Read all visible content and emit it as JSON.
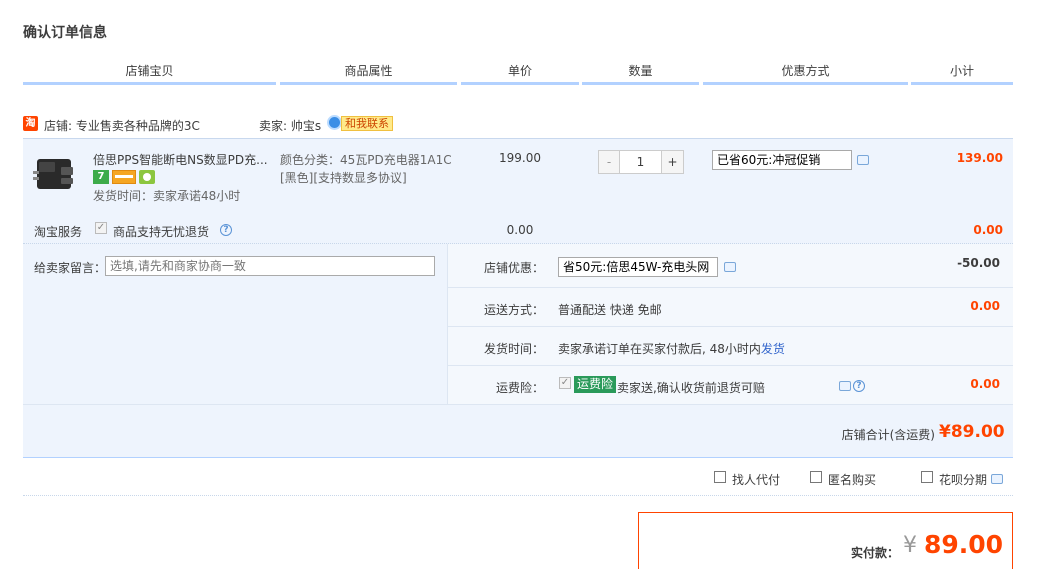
{
  "page": {
    "title": "确认订单信息"
  },
  "columns": [
    "店铺宝贝",
    "商品属性",
    "单价",
    "数量",
    "优惠方式",
    "小计"
  ],
  "shop": {
    "taobao_badge": "淘",
    "shop_label": "店铺: 专业售卖各种品牌的3C",
    "seller_label": "卖家: 帅宝s",
    "contact_label": "和我联系"
  },
  "item": {
    "name": "倍思PPS智能断电NS数显PD充...",
    "badge_7": "7",
    "ship_time": "发货时间：卖家承诺48小时",
    "attr_line1": "颜色分类：45瓦PD充电器1A1C",
    "attr_line2": "[黑色][支持数显多协议]",
    "unit_price": "199.00",
    "qty_minus": "-",
    "qty_value": "1",
    "qty_plus": "+",
    "discount_value": "已省60元:冲冠促销",
    "subtotal": "139.00"
  },
  "service": {
    "label": "淘宝服务",
    "option_label": "商品支持无忧退货",
    "price": "0.00",
    "subtotal": "0.00"
  },
  "message": {
    "label": "给卖家留言：",
    "placeholder": "选填,请先和商家协商一致"
  },
  "shop_discount": {
    "label": "店铺优惠：",
    "value": "省50元:倍思45W-充电头网",
    "amount": "-50.00"
  },
  "shipping": {
    "label": "运送方式：",
    "value": "普通配送 快递 免邮",
    "amount": "0.00"
  },
  "ship_time": {
    "label": "发货时间：",
    "value_prefix": "卖家承诺订单在买家付款后, 48小时内",
    "value_link": "发货"
  },
  "insurance": {
    "label": "运费险：",
    "tag": "运费险",
    "desc": "卖家送,确认收货前退货可赔",
    "amount": "0.00"
  },
  "shop_total": {
    "label": "店铺合计(含运费)",
    "amount": "¥89.00"
  },
  "options": {
    "proxy": "找人代付",
    "anonymous": "匿名购买",
    "huabei": "花呗分期"
  },
  "pay": {
    "label": "实付款：",
    "currency": "¥",
    "amount": "89.00"
  },
  "colors": {
    "accent_orange": "#ff4400",
    "header_bar": "#b2d1ff",
    "panel_bg": "#eef4fd",
    "insurance_tag": "#2a9a5a"
  }
}
